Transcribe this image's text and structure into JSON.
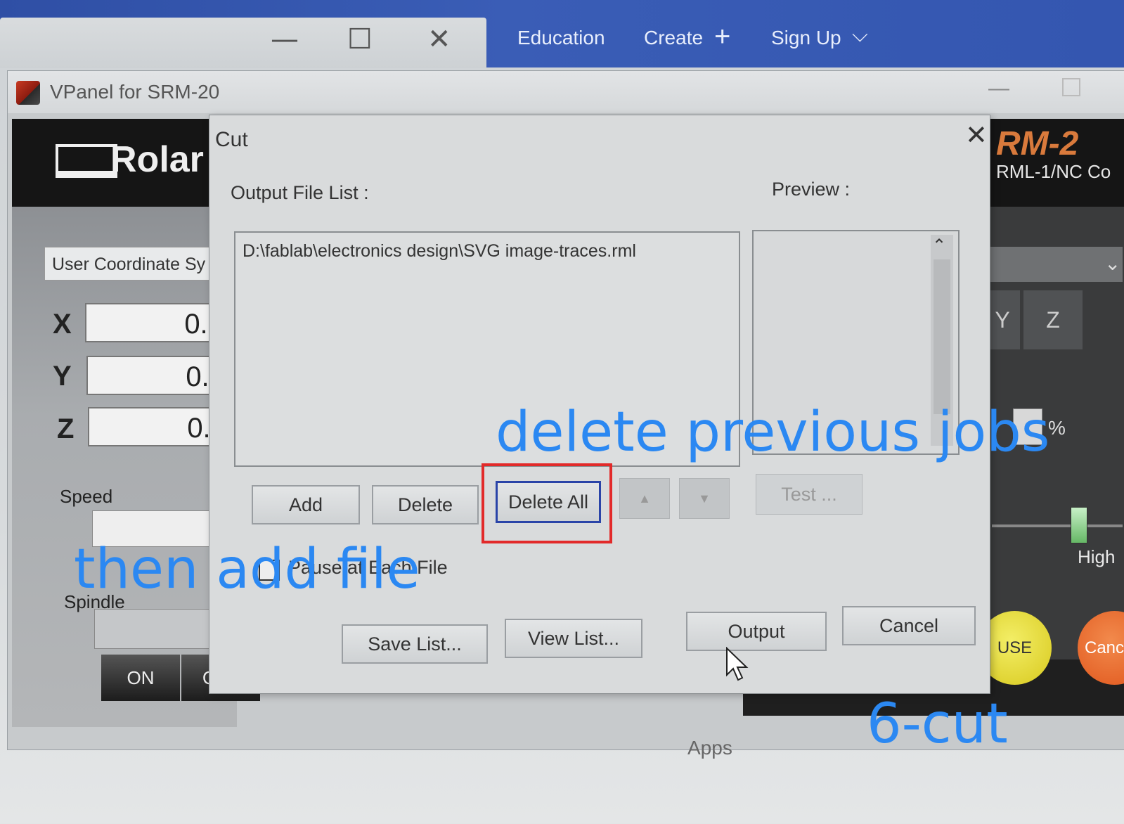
{
  "browser": {
    "window_controls": {
      "minimize": "—",
      "maximize": "☐",
      "close": "✕"
    },
    "nav": {
      "education": "Education",
      "create": "Create",
      "create_icon": "+",
      "signup": "Sign Up",
      "signup_icon": "⌵"
    }
  },
  "vpanel": {
    "title": "VPanel for SRM-20",
    "brand": "Rolar",
    "model": "RM-2",
    "subtitle": "RML-1/NC Co",
    "coordinate_system": "User Coordinate Sy",
    "axes": [
      {
        "label": "X",
        "value": "0.("
      },
      {
        "label": "Y",
        "value": "0.("
      },
      {
        "label": "Z",
        "value": "0.("
      }
    ],
    "speed_label": "Speed",
    "spindle_label": "Spindle",
    "on_label": "ON",
    "off_label": "OF",
    "axis_y_label": "Y",
    "axis_z_label": "Z",
    "percent_label": "%",
    "high_label": "High",
    "pause_label": "USE",
    "cancel_label": "Canc",
    "apps_label": "Apps",
    "colors": {
      "pause": "#f3ee66",
      "cancel": "#e0561c",
      "model": "#d97a3c"
    }
  },
  "cut_dialog": {
    "title": "Cut",
    "close_icon": "✕",
    "output_file_list_label": "Output File List :",
    "preview_label": "Preview :",
    "files": [
      "D:\\fablab\\electronics design\\SVG image-traces.rml"
    ],
    "buttons": {
      "add": "Add",
      "delete": "Delete",
      "delete_all": "Delete All",
      "up": "▲",
      "down": "▼",
      "test": "Test ...",
      "save_list": "Save List...",
      "view_list": "View List...",
      "output": "Output",
      "cancel": "Cancel"
    },
    "pause_checkbox_label": "Pause at Each File",
    "pause_checked": false
  },
  "annotations": {
    "delete": "delete previous jobs",
    "add": "then add file",
    "cut": "6-cut",
    "color": "#2b88f2",
    "highlight_color": "#e22a2a"
  }
}
